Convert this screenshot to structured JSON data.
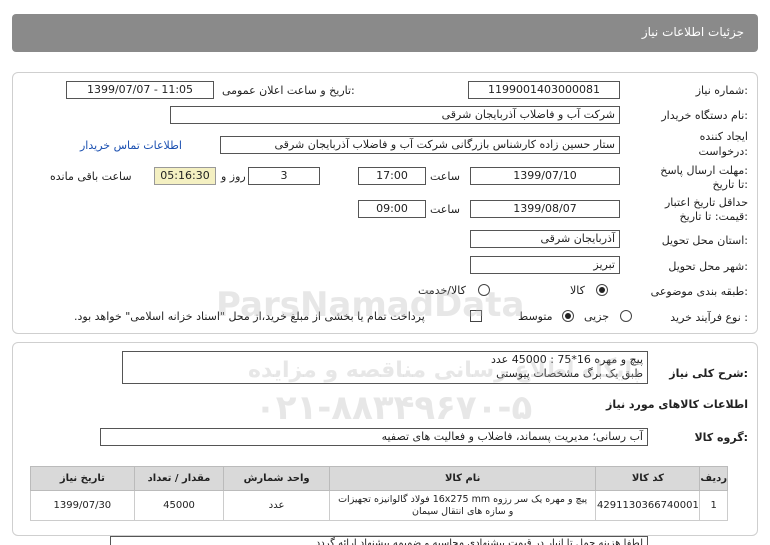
{
  "header": {
    "title": "جزئیات اطلاعات نیاز"
  },
  "labels": {
    "need_number": "شماره نیاز:",
    "announce_datetime": "تاریخ و ساعت اعلان عمومی:",
    "buyer_org": "نام دستگاه خریدار:",
    "requester_line1": "ایجاد کننده",
    "requester_line2": "درخواست:",
    "reply_deadline_line1": "مهلت ارسال پاسخ:",
    "reply_deadline_line2": "تا تاریخ:",
    "hour": "ساعت",
    "day_and": "روز و",
    "remaining": "ساعت باقی مانده",
    "price_validity_line1": "حداقل تاریخ اعتبار",
    "price_validity_line2": "قیمت: تا تاریخ:",
    "delivery_province": "استان محل تحویل:",
    "delivery_city": "شهر محل تحویل:",
    "category": "طبقه بندی موضوعی:",
    "process_type": "نوع فرآیند خرید :",
    "need_description": "شرح کلی نیاز:",
    "goods_info": "اطلاعات کالاهای مورد نیاز",
    "goods_group": "گروه کالا:"
  },
  "values": {
    "need_number": "1199001403000081",
    "announce_datetime": "1399/07/07 - 11:05",
    "buyer_org": "شرکت آب و فاضلاب آذربایجان شرقی",
    "requester": "ستار حسین زاده کارشناس بازرگانی شرکت آب و فاضلاب آذربایجان شرقی",
    "contact_link": "اطلاعات تماس خریدار",
    "reply_date": "1399/07/10",
    "reply_time": "17:00",
    "days": "3",
    "countdown": "05:16:30",
    "validity_date": "1399/08/07",
    "validity_time": "09:00",
    "province": "آذربایجان شرقی",
    "city": "تبریز",
    "category_options": [
      "کالا",
      "کالا/خدمت"
    ],
    "process_options": [
      "جزیی",
      "متوسط"
    ],
    "payment_note": "پرداخت تمام یا بخشی از مبلغ خرید،از محل \"اسناد خزانه اسلامی\" خواهد بود.",
    "description_line1": "پیچ و مهره 16*75 : 45000 عدد",
    "description_line2": "طبق یک برگ مشخصات پیوستی",
    "goods_group": "آب رسانی؛ مدیریت پسماند، فاضلاب و فعالیت های تصفیه",
    "bottom_text": "لطفا هزینه حمل تا انبار در قیمت پیشنهادی محاسبه و ضمیمه پیشنهاد ارائه گردد"
  },
  "watermark": {
    "brand": "ParsNamadData",
    "line1": "پایگاه اطلاع رسانی مناقصه و مزایده",
    "phone": "۰۲۱-۸۸۳۴۹۶۷۰-۵"
  },
  "table": {
    "headers": [
      "ردیف",
      "کد کالا",
      "نام کالا",
      "واحد شمارش",
      "مقدار / تعداد",
      "تاریخ نیاز"
    ],
    "rows": [
      {
        "row": "1",
        "code": "4291130366740001",
        "name_line1": "پیچ و مهره یک سر رزوه 16x275 mm فولاد گالوانیزه تجهیزات",
        "name_line2": "و سازه های انتقال سیمان",
        "unit": "عدد",
        "quantity": "45000",
        "date": "1399/07/30"
      }
    ]
  }
}
